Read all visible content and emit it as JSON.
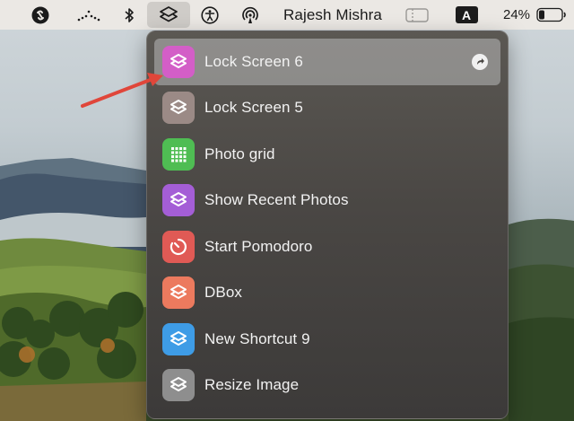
{
  "menubar": {
    "user_name": "Rajesh Mishra",
    "keyboard_indicator": "A",
    "battery_percent": "24%"
  },
  "shortcuts_menu": {
    "items": [
      {
        "label": "Lock Screen 6",
        "icon": "shortcuts-icon",
        "color": "#d35ec7",
        "highlighted": true
      },
      {
        "label": "Lock Screen 5",
        "icon": "shortcuts-icon",
        "color": "#9b8a86"
      },
      {
        "label": "Photo grid",
        "icon": "grid-icon",
        "color": "#4fbd53"
      },
      {
        "label": "Show Recent Photos",
        "icon": "shortcuts-icon",
        "color": "#a45ed6"
      },
      {
        "label": "Start Pomodoro",
        "icon": "timer-icon",
        "color": "#e05a55"
      },
      {
        "label": "DBox",
        "icon": "shortcuts-icon",
        "color": "#ec7a5e"
      },
      {
        "label": "New Shortcut 9",
        "icon": "shortcuts-icon",
        "color": "#3e9ce6"
      },
      {
        "label": "Resize Image",
        "icon": "shortcuts-icon",
        "color": "#8e8e8e"
      }
    ]
  },
  "colors": {
    "menubar_bg": "#ebe8e4",
    "menu_bg": "#4a4744",
    "annotation_arrow": "#e0463a"
  }
}
